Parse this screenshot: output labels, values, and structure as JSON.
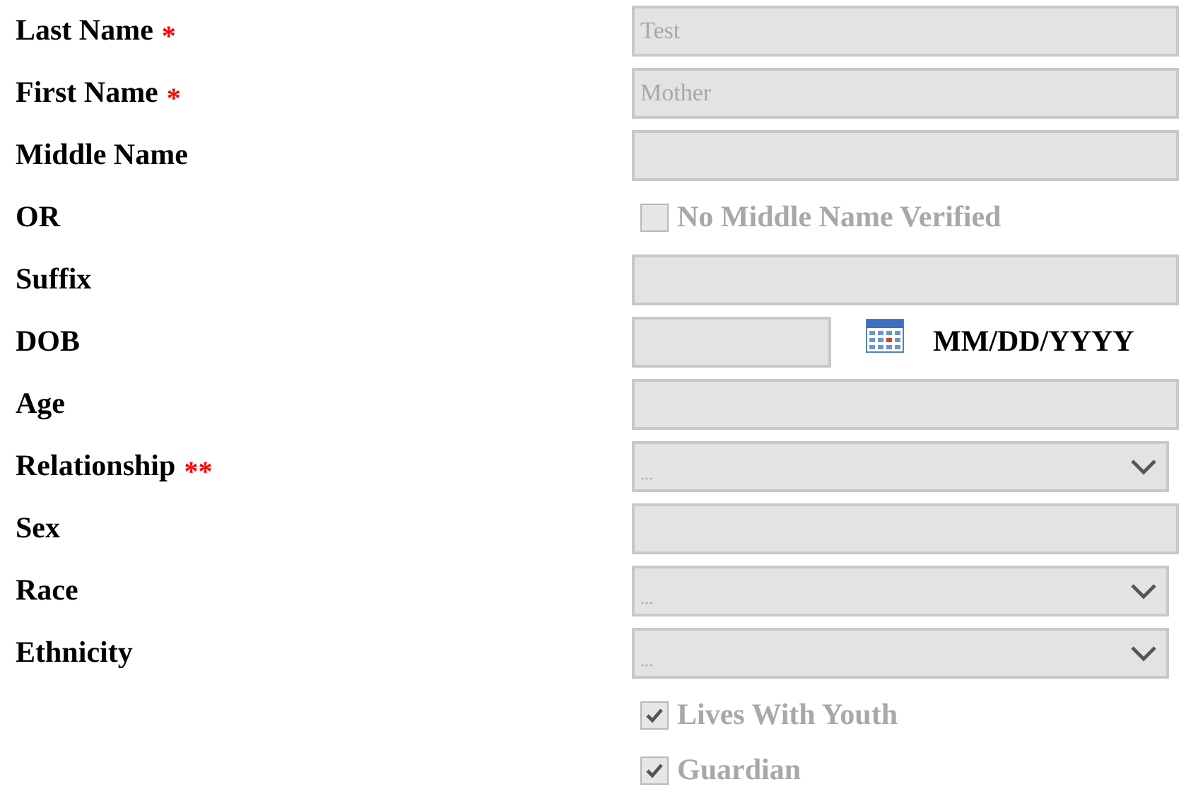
{
  "rows": [
    {
      "kind": "text",
      "label": "Last Name",
      "required": "*",
      "value": "Test",
      "disabled": true
    },
    {
      "kind": "text",
      "label": "First Name",
      "required": "*",
      "value": "Mother",
      "disabled": true
    },
    {
      "kind": "text",
      "label": "Middle Name",
      "disabled": true
    },
    {
      "kind": "checkbox",
      "label": "OR",
      "option": "No Middle Name Verified",
      "checked": false,
      "disabled": true
    },
    {
      "kind": "text",
      "label": "Suffix",
      "disabled": true
    },
    {
      "kind": "date",
      "label": "DOB",
      "hint": "MM/DD/YYYY",
      "disabled": true
    },
    {
      "kind": "text",
      "label": "Age",
      "disabled": true
    },
    {
      "kind": "select",
      "label": "Relationship",
      "required": "**",
      "value": "...",
      "disabled": true
    },
    {
      "kind": "text",
      "label": "Sex",
      "disabled": true
    },
    {
      "kind": "select",
      "label": "Race",
      "value": "...",
      "disabled": true
    },
    {
      "kind": "select",
      "label": "Ethnicity",
      "value": "...",
      "disabled": true
    },
    {
      "kind": "checkbox",
      "option": "Lives With Youth",
      "checked": true,
      "disabled": true
    },
    {
      "kind": "checkbox",
      "option": "Guardian",
      "checked": true,
      "disabled": true
    }
  ]
}
